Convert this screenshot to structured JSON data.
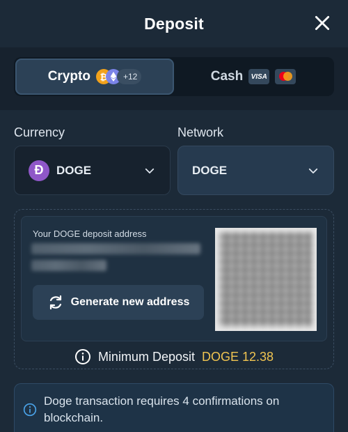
{
  "header": {
    "title": "Deposit"
  },
  "tabs": [
    {
      "label": "Crypto",
      "extra_count": "+12",
      "active": true
    },
    {
      "label": "Cash",
      "card_brand": "VISA",
      "active": false
    }
  ],
  "currency": {
    "label": "Currency",
    "selected": "DOGE",
    "logo_glyph": "Ð"
  },
  "network": {
    "label": "Network",
    "selected": "DOGE"
  },
  "address": {
    "label": "Your DOGE deposit address",
    "generate_label": "Generate new address"
  },
  "minimum": {
    "label": "Minimum Deposit",
    "amount": "DOGE 12.38"
  },
  "info": {
    "text": "Doge transaction requires 4 confirmations on blockchain."
  },
  "colors": {
    "background": "#1c2a38",
    "accent_gold": "#f0c451",
    "doge_purple": "#8f57c8",
    "info_blue": "#4aa3e8"
  }
}
